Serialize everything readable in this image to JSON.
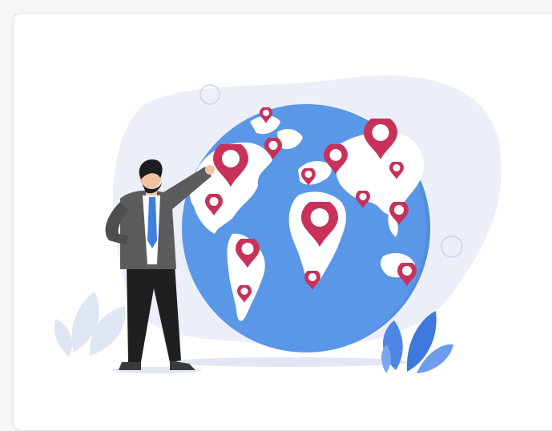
{
  "card": {
    "illustration": {
      "subject": "business-person-pointing-at-globe",
      "icons": [
        "globe-icon",
        "location-pin-icon",
        "leaf-icon",
        "bubble-icon",
        "person-icon"
      ]
    }
  },
  "colors": {
    "ocean": "#5a97e6",
    "land": "#ffffff",
    "pin": "#c8325a",
    "blob": "#eceef8",
    "leaf_blue": "#4f86e6",
    "leaf_light": "#dfe5f3",
    "suit": "#5c5c5e",
    "shirt_tie": "#3f7fe0",
    "pants": "#1f1f22"
  }
}
